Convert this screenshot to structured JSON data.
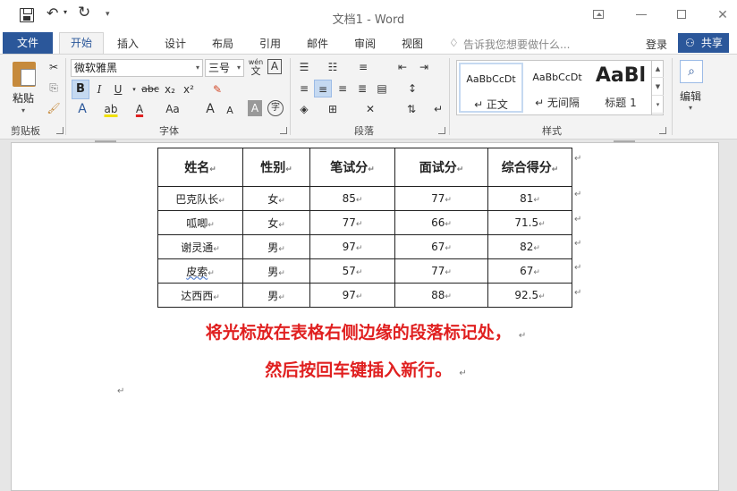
{
  "window": {
    "title": "文档1 - Word"
  },
  "quick_access": {
    "save_icon": "save-icon",
    "undo_icon": "undo-icon",
    "redo_icon": "redo-icon"
  },
  "tabs": {
    "file": "文件",
    "home": "开始",
    "insert": "插入",
    "design": "设计",
    "layout": "布局",
    "references": "引用",
    "mailings": "邮件",
    "review": "审阅",
    "view": "视图",
    "tell_me": "告诉我您想要做什么...",
    "sign_in": "登录",
    "share": "共享"
  },
  "ribbon": {
    "clipboard": {
      "paste": "粘贴",
      "label": "剪贴板"
    },
    "font": {
      "name": "微软雅黑",
      "size": "三号",
      "wen_icon": "wén",
      "wen_icon_char": "文",
      "A_box": "A",
      "bold": "B",
      "italic": "I",
      "underline": "U",
      "strike": "abc",
      "subscript": "x₂",
      "superscript": "x²",
      "text_effect": "A",
      "highlight": "ab",
      "font_color": "A",
      "change_case": "Aa",
      "grow": "A",
      "shrink": "A",
      "char_shade": "A",
      "enclose": "字",
      "label": "字体"
    },
    "paragraph": {
      "label": "段落"
    },
    "styles": {
      "items": [
        {
          "sample": "AaBbCcDt",
          "name": "↵ 正文"
        },
        {
          "sample": "AaBbCcDt",
          "name": "↵ 无间隔"
        },
        {
          "sample": "AaBl",
          "name": "标题 1"
        }
      ],
      "label": "样式"
    },
    "editing": {
      "label": "编辑"
    }
  },
  "document": {
    "table": {
      "headers": [
        "姓名",
        "性别",
        "笔试分",
        "面试分",
        "综合得分"
      ],
      "rows": [
        [
          "巴克队长",
          "女",
          "85",
          "77",
          "81"
        ],
        [
          "呱唧",
          "女",
          "77",
          "66",
          "71.5"
        ],
        [
          "谢灵通",
          "男",
          "97",
          "67",
          "82"
        ],
        [
          "皮索",
          "男",
          "57",
          "77",
          "67"
        ],
        [
          "达西西",
          "男",
          "97",
          "88",
          "92.5"
        ]
      ]
    },
    "note_line1": "将光标放在表格右侧边缘的段落标记处，",
    "note_line2": "然后按回车键插入新行。",
    "paragraph_mark": "↵",
    "accent_color": "#2b579a",
    "note_color": "#e02020"
  }
}
